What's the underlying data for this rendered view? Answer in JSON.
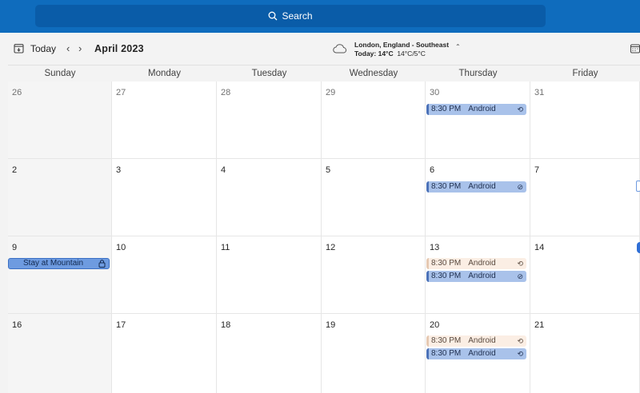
{
  "search": {
    "label": "Search",
    "icon": "search-icon"
  },
  "toolbar": {
    "today_label": "Today",
    "prev_glyph": "‹",
    "next_glyph": "›",
    "month_title": "April 2023"
  },
  "weather": {
    "location": "London, England - Southeast",
    "today_prefix": "Today: ",
    "today_temp": "14°C",
    "range": "14°C/5°C"
  },
  "weekdays": [
    "Sunday",
    "Monday",
    "Tuesday",
    "Wednesday",
    "Thursday",
    "Friday"
  ],
  "weeks": [
    [
      "26",
      "27",
      "28",
      "29",
      "30",
      "31"
    ],
    [
      "2",
      "3",
      "4",
      "5",
      "6",
      "7"
    ],
    [
      "9",
      "10",
      "11",
      "12",
      "13",
      "14"
    ],
    [
      "16",
      "17",
      "18",
      "19",
      "20",
      "21"
    ]
  ],
  "events": {
    "w0_thu": {
      "time": "8:30 PM",
      "title": "Android",
      "icon": "recurring-icon"
    },
    "w1_thu": {
      "time": "8:30 PM",
      "title": "Android",
      "icon": "recurring-off-icon"
    },
    "w2_thu_a": {
      "time": "8:30 PM",
      "title": "Android",
      "icon": "recurring-icon"
    },
    "w2_thu_b": {
      "time": "8:30 PM",
      "title": "Android",
      "icon": "recurring-off-icon"
    },
    "w3_thu_a": {
      "time": "8:30 PM",
      "title": "Android",
      "icon": "recurring-icon"
    },
    "w3_thu_b": {
      "time": "8:30 PM",
      "title": "Android",
      "icon": "recurring-icon"
    }
  },
  "allday_event": {
    "title": "Stay at Mountain",
    "icon": "lock-icon"
  },
  "colors": {
    "topbar": "#0f6cbd",
    "event_blue": "#a9c2ea",
    "event_peach": "#fbeee4",
    "allday": "#6e9be0"
  }
}
